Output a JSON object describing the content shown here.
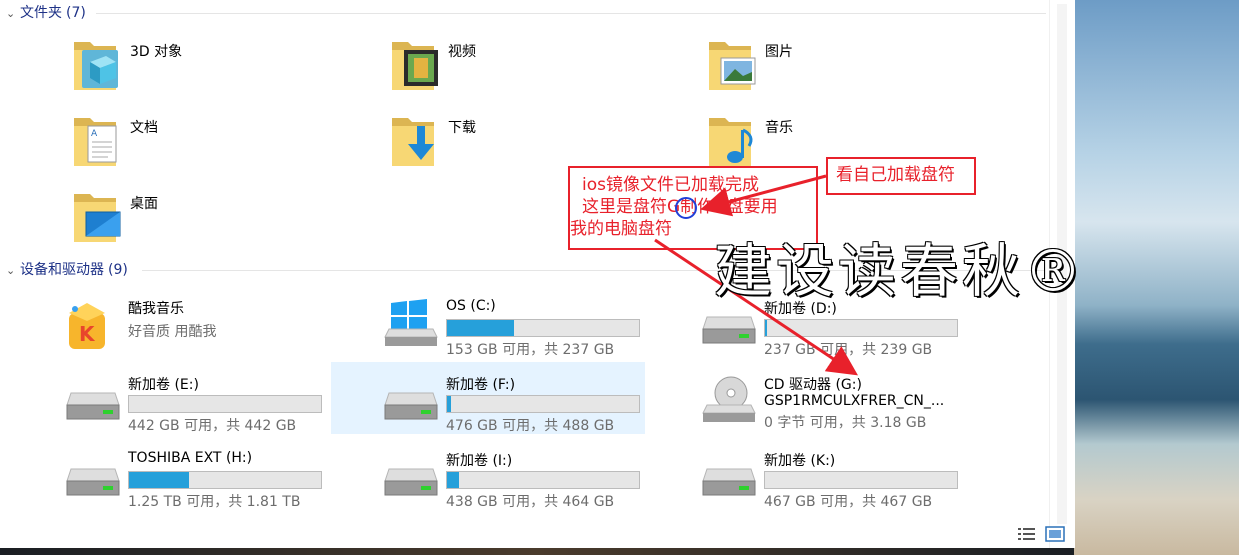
{
  "folders_group": {
    "title": "文件夹",
    "count": "(7)"
  },
  "folders": [
    {
      "label": "3D 对象",
      "icon": "3d-objects-folder-icon"
    },
    {
      "label": "视频",
      "icon": "videos-folder-icon"
    },
    {
      "label": "图片",
      "icon": "pictures-folder-icon"
    },
    {
      "label": "文档",
      "icon": "documents-folder-icon"
    },
    {
      "label": "下载",
      "icon": "downloads-folder-icon"
    },
    {
      "label": "音乐",
      "icon": "music-folder-icon"
    },
    {
      "label": "桌面",
      "icon": "desktop-folder-icon"
    }
  ],
  "devices_group": {
    "title": "设备和驱动器",
    "count": "(9)"
  },
  "drives": [
    {
      "name": "酷我音乐",
      "size": "好音质 用酷我",
      "type": "app",
      "fill": null
    },
    {
      "name": "OS (C:)",
      "size": "153 GB 可用，共 237 GB",
      "type": "windows",
      "fill": 0.35
    },
    {
      "name": "新加卷 (D:)",
      "size": "237 GB 可用，共 239 GB",
      "type": "disk",
      "fill": 0.01
    },
    {
      "name": "新加卷 (E:)",
      "size": "442 GB 可用，共 442 GB",
      "type": "disk",
      "fill": 0.0
    },
    {
      "name": "新加卷 (F:)",
      "size": "476 GB 可用，共 488 GB",
      "type": "disk",
      "fill": 0.02
    },
    {
      "name": "CD 驱动器 (G:)",
      "name2": "GSP1RMCULXFRER_CN_...",
      "size": "0 字节 可用，共 3.18 GB",
      "type": "cd",
      "fill": null
    },
    {
      "name": "TOSHIBA EXT (H:)",
      "size": "1.25 TB 可用，共 1.81 TB",
      "type": "disk",
      "fill": 0.31
    },
    {
      "name": "新加卷 (I:)",
      "size": "438 GB 可用，共 464 GB",
      "type": "disk",
      "fill": 0.06
    },
    {
      "name": "新加卷 (K:)",
      "size": "467 GB 可用，共 467 GB",
      "type": "disk",
      "fill": 0.0
    }
  ],
  "annotations": {
    "note_lines": [
      "ios镜像文件已加载完成",
      "这里是盘符G制作U盘要用",
      "我的电脑盘符"
    ],
    "callout": "看自己加载盘符",
    "color": "#e8212b"
  },
  "watermark": "建设读春秋®",
  "colors": {
    "accent": "#26a0da",
    "header": "#1e3287",
    "selected": "#e5f3ff"
  }
}
